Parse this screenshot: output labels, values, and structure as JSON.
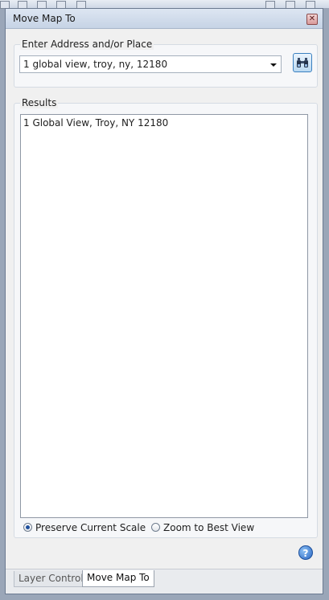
{
  "window": {
    "title": "Move Map To"
  },
  "address": {
    "group_label": "Enter Address and/or Place",
    "value": "1 global view, troy, ny, 12180"
  },
  "results": {
    "group_label": "Results",
    "items": [
      "1 Global View, Troy, NY 12180"
    ]
  },
  "scale_options": [
    {
      "label": "Preserve Current Scale",
      "checked": true
    },
    {
      "label": "Zoom to Best View",
      "checked": false
    }
  ],
  "tabs": [
    {
      "label": "Layer Control",
      "active": false
    },
    {
      "label": "Move Map To",
      "active": true
    }
  ],
  "icons": {
    "close": "close-icon",
    "search": "binoculars-icon",
    "help": "help-icon"
  },
  "colors": {
    "accent": "#3b80c0"
  }
}
